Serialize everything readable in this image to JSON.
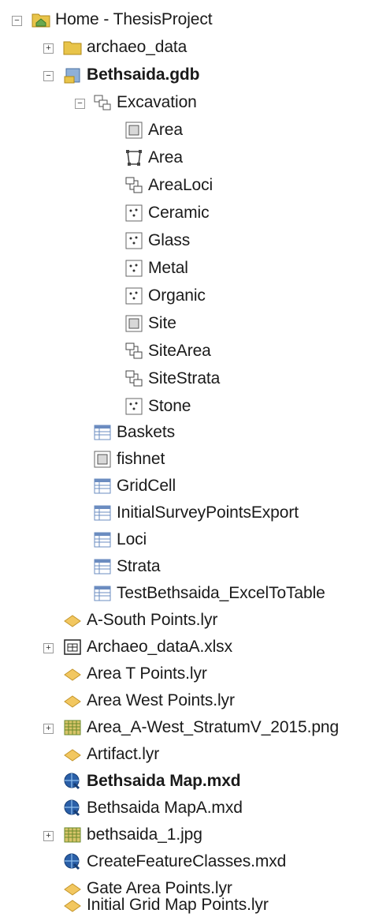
{
  "tree": {
    "root": "Home - ThesisProject",
    "archaeo_data": "archaeo_data",
    "gdb": "Bethsaida.gdb",
    "dataset": "Excavation",
    "fc": [
      "Area",
      "Area",
      "AreaLoci",
      "Ceramic",
      "Glass",
      "Metal",
      "Organic",
      "Site",
      "SiteArea",
      "SiteStrata",
      "Stone"
    ],
    "tables": [
      "Baskets",
      "fishnet",
      "GridCell",
      "InitialSurveyPointsExport",
      "Loci",
      "Strata",
      "TestBethsaida_ExcelToTable"
    ],
    "files": [
      "A-South Points.lyr",
      "Archaeo_dataA.xlsx",
      "Area T Points.lyr",
      "Area West Points.lyr",
      "Area_A-West_StratumV_2015.png",
      "Artifact.lyr",
      "Bethsaida Map.mxd",
      "Bethsaida MapA.mxd",
      "bethsaida_1.jpg",
      "CreateFeatureClasses.mxd",
      "Gate Area Points.lyr",
      "Initial Grid Map Points.lyr"
    ]
  },
  "icons": {
    "folder_home": "home-folder-icon",
    "folder": "folder-icon",
    "gdb": "geodatabase-icon",
    "dataset": "feature-dataset-icon",
    "polygon_fc": "polygon-feature-class-icon",
    "topology": "topology-icon",
    "relationship": "relationship-class-icon",
    "point_fc": "point-feature-class-icon",
    "table": "table-icon",
    "layer": "layer-file-icon",
    "excel": "excel-workbook-icon",
    "raster": "raster-icon",
    "mxd": "map-document-icon"
  },
  "colors": {
    "folder": "#e8c44a",
    "layer": "#f2c760",
    "mxd": "#2a5fa8",
    "raster": "#6a8a2a",
    "table": "#6b8cc0"
  }
}
